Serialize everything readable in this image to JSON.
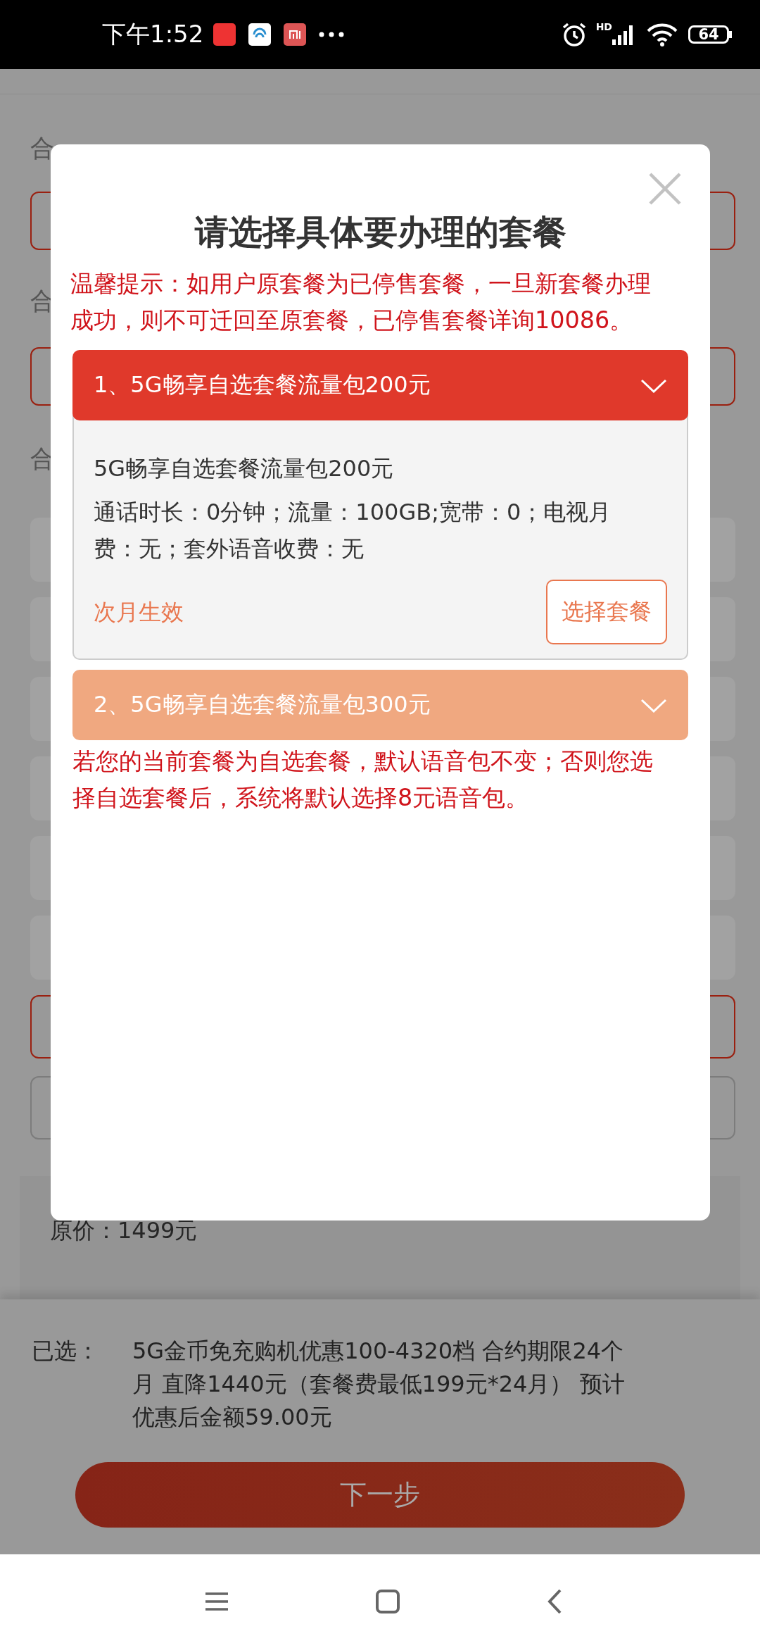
{
  "status_bar": {
    "time": "下午1:52",
    "network": "HD",
    "battery": "64"
  },
  "background": {
    "section_labels": [
      "合",
      "合",
      "合"
    ],
    "price": "原价：1499元"
  },
  "modal": {
    "title": "请选择具体要办理的套餐",
    "notice": "温馨提示：如用户原套餐为已停售套餐，一旦新套餐办理成功，则不可迁回至原套餐，已停售套餐详询10086。",
    "packages": [
      {
        "label": "1、5G畅享自选套餐流量包200元",
        "expanded": true,
        "detail_title": "5G畅享自选套餐流量包200元",
        "detail": "通话时长：0分钟；流量：100GB;宽带：0；电视月费：无；套外语音收费：无",
        "effective": "次月生效",
        "select_button": "选择套餐"
      },
      {
        "label": "2、5G畅享自选套餐流量包300元",
        "expanded": false
      }
    ],
    "footnote": "若您的当前套餐为自选套餐，默认语音包不变；否则您选择自选套餐后，系统将默认选择8元语音包。"
  },
  "bottom_bar": {
    "label": "已选：",
    "summary": "5G金币免充购机优惠100-4320档 合约期限24个月 直降1440元（套餐费最低199元*24月） 预计优惠后金额59.00元",
    "next_button": "下一步"
  }
}
